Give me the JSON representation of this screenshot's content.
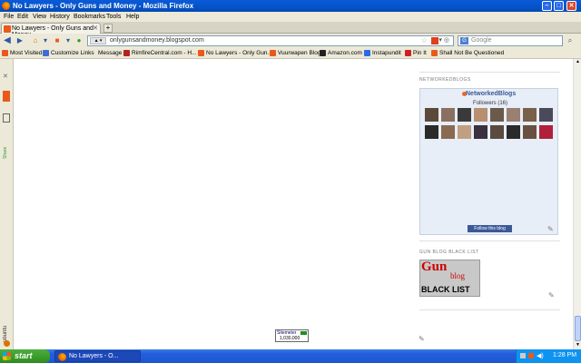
{
  "window": {
    "title": "No Lawyers - Only Guns and Money - Mozilla Firefox",
    "minimize_icon": "minimize-icon",
    "maximize_icon": "maximize-icon",
    "close_icon": "close-icon"
  },
  "menu": [
    "File",
    "Edit",
    "View",
    "History",
    "Bookmarks",
    "Tools",
    "Help"
  ],
  "tab": {
    "label": "No Lawyers - Only Guns and Money",
    "new_tab": "+"
  },
  "nav": {
    "url": "onlygunsandmoney.blogspot.com",
    "search_placeholder": "Google"
  },
  "bookmarks": [
    {
      "label": "Most Visited",
      "color": "#e9591a"
    },
    {
      "label": "Customize Links",
      "color": "#3b6fd6"
    },
    {
      "label": "Message",
      "color": "#888888"
    },
    {
      "label": "RimfireCentral.com - H...",
      "color": "#b22222"
    },
    {
      "label": "No Lawyers - Only Gun...",
      "color": "#e9591a"
    },
    {
      "label": "Vuurwapen Blog",
      "color": "#e9591a"
    },
    {
      "label": "Amazon.com",
      "color": "#222222"
    },
    {
      "label": "Instapundit",
      "color": "#2a6ae8"
    },
    {
      "label": "Pin It",
      "color": "#cc2127"
    },
    {
      "label": "Shall Not Be Questioned",
      "color": "#e9591a"
    }
  ],
  "sidebar": {
    "share_label": "Share",
    "brand": "ubuntu"
  },
  "content": {
    "networked_title": "NETWORKEDBLOGS",
    "nb_brand": "NetworkedBlogs",
    "followers": "Followers (16)",
    "follow_btn": "Follow this blog",
    "gbl_title": "GUN BLOG BLACK LIST",
    "gbl_gun": "Gun",
    "gbl_blog": "blog",
    "gbl_black": "BLACK LIST",
    "sitemeter": "Sitemeter",
    "sitemeter_count": "1,030,000"
  },
  "taskbar": {
    "start": "start",
    "item": "No Lawyers - O...",
    "time": "1:28 PM"
  }
}
